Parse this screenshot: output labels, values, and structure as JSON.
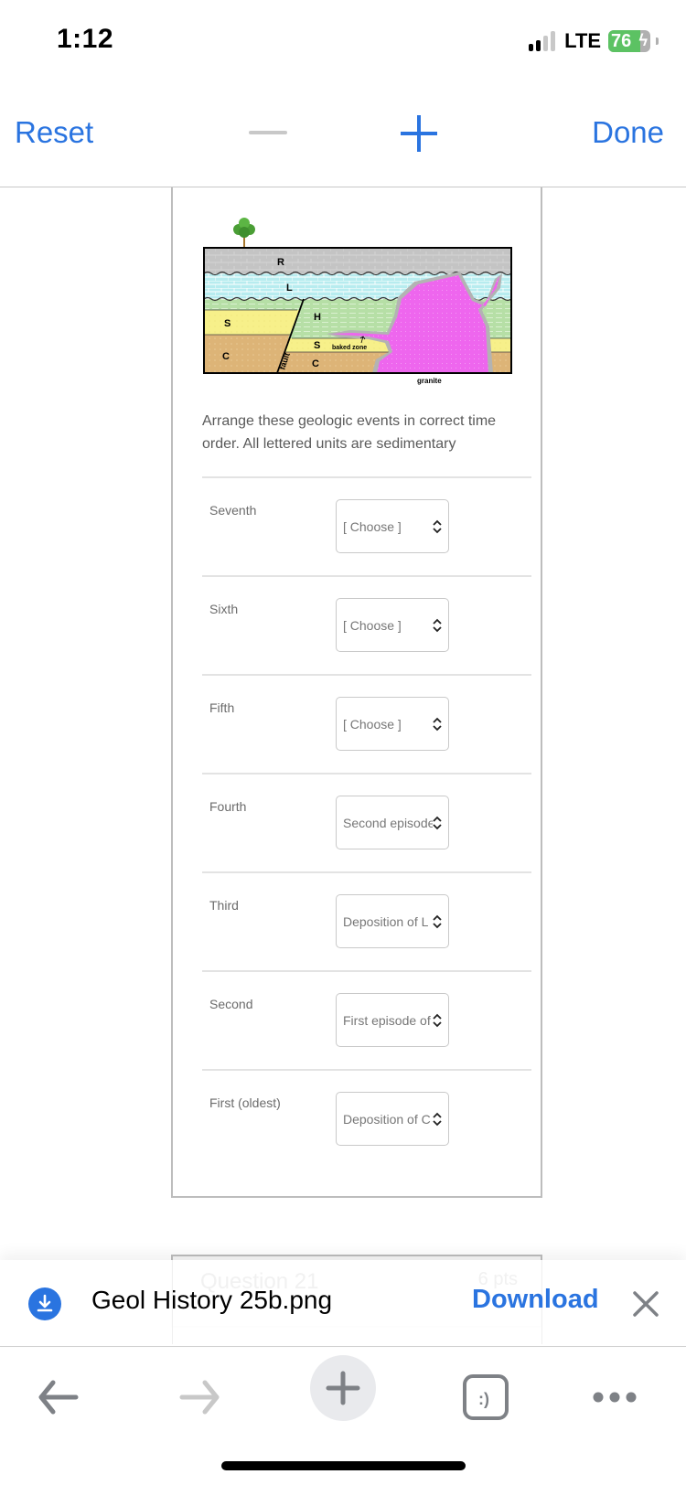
{
  "status_bar": {
    "time": "1:12",
    "network": "LTE",
    "battery_percent": 76,
    "battery_label": "76",
    "charging": true,
    "signal_bars_active": 2,
    "signal_bars_total": 4
  },
  "zoom_toolbar": {
    "reset_label": "Reset",
    "done_label": "Done",
    "zoom_out_icon": "minus-icon",
    "zoom_in_icon": "plus-icon"
  },
  "question": {
    "diagram": {
      "labels": {
        "R": "R",
        "L": "L",
        "H": "H",
        "S_left": "S",
        "S_right": "S",
        "C_left": "C",
        "C_right": "C",
        "fault": "fault",
        "baked_zone": "baked zone",
        "granite": "granite"
      },
      "colors": {
        "R": "#c4c4c4",
        "L": "#b7ecef",
        "H": "#b6dfa6",
        "S": "#f7f08a",
        "C": "#ddb477",
        "granite": "#ee66ee",
        "baked": "#b3b3b3"
      }
    },
    "prompt": "Arrange these geologic events in correct time order.  All lettered units are sedimentary",
    "rows": [
      {
        "label": "Seventh",
        "value": "[ Choose ]"
      },
      {
        "label": "Sixth",
        "value": "[ Choose ]"
      },
      {
        "label": "Fifth",
        "value": "[ Choose ]"
      },
      {
        "label": "Fourth",
        "value": "Second episode"
      },
      {
        "label": "Third",
        "value": "Deposition of L"
      },
      {
        "label": "Second",
        "value": "First episode of"
      },
      {
        "label": "First (oldest)",
        "value": "Deposition of C"
      }
    ]
  },
  "next_question": {
    "title": "Question 21",
    "points": "6 pts"
  },
  "download_bar": {
    "filename": "Geol History 25b.png",
    "download_label": "Download",
    "icon": "download-icon",
    "close_icon": "close-icon"
  },
  "browser_nav": {
    "back_icon": "back-arrow-icon",
    "forward_icon": "forward-arrow-icon",
    "new_tab_icon": "plus-icon",
    "tabs_icon": "tabs-icon",
    "tabs_glyph": ":)",
    "menu_icon": "more-icon"
  },
  "colors": {
    "accent": "#2a74e0",
    "disabled": "#c8c8c8",
    "icon_gray": "#7e8186"
  }
}
